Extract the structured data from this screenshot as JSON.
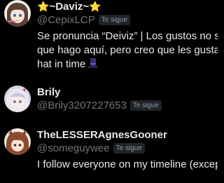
{
  "users": [
    {
      "display_name_text": "~Daviz~",
      "display_name_prefix_icon": "star-emoji",
      "display_name_suffix_icon": "star-emoji",
      "handle": "@CepixLCP",
      "follows_you": "Te sigue",
      "bio_lines": [
        "Se pronuncia “Deiviz” | Los gustos no se",
        "que hago aquí, pero creo que les gusta | I",
        "hat in time"
      ],
      "bio_trailing_icon": "top-hat-emoji",
      "avatar_icon": "anime-girl-avatar"
    },
    {
      "display_name": "Brily",
      "handle": "@Brily3207227653",
      "follows_you": "Te sigue",
      "avatar_icon": "anime-girl-avatar"
    },
    {
      "display_name": "TheLESSERAgnesGooner",
      "handle": "@someguywee",
      "follows_you": "Te sigue",
      "bio_lines": [
        "I follow everyone on my timeline (except"
      ],
      "avatar_icon": "anime-character-avatar"
    }
  ],
  "colors": {
    "background": "#000000",
    "primary_text": "#e7e9ea",
    "secondary_text": "#71767b",
    "badge_bg": "#202327",
    "badge_text": "#8b98a5"
  }
}
